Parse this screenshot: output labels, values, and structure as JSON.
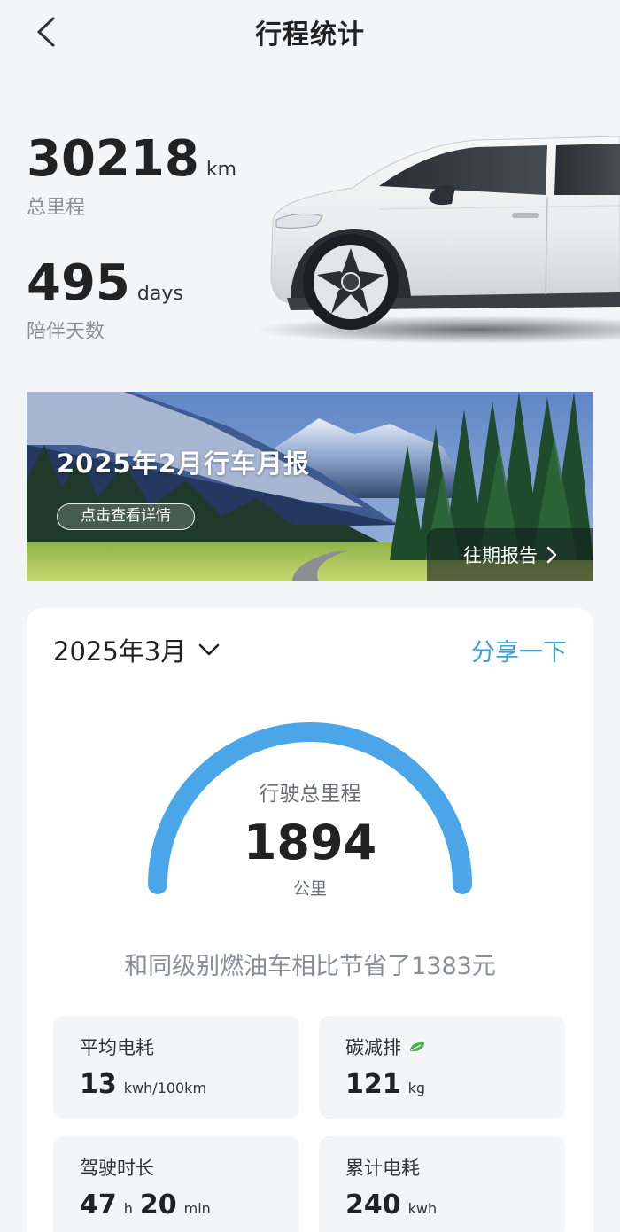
{
  "header": {
    "title": "行程统计"
  },
  "summary": {
    "total_mileage": {
      "value": "30218",
      "unit": "km",
      "label": "总里程"
    },
    "days": {
      "value": "495",
      "unit": "days",
      "label": "陪伴天数"
    }
  },
  "banner": {
    "title": "2025年2月行车月报",
    "detail_button": "点击查看详情",
    "history_button": "往期报告"
  },
  "card": {
    "month": "2025年3月",
    "share": "分享一下",
    "gauge": {
      "label": "行驶总里程",
      "value": "1894",
      "unit": "公里",
      "progress": 1.0
    },
    "saving_text": "和同级别燃油车相比节省了1383元",
    "tiles": [
      {
        "label": "平均电耗",
        "value": "13",
        "unit": "kwh/100km"
      },
      {
        "label": "碳减排",
        "value": "121",
        "unit": "kg"
      },
      {
        "label": "驾驶时长",
        "hours": "47",
        "hours_unit": "h",
        "minutes": "20",
        "minutes_unit": "min"
      },
      {
        "label": "累计电耗",
        "value": "240",
        "unit": "kwh"
      }
    ]
  },
  "colors": {
    "accent": "#3aa1dd",
    "gauge": "#4aa6e8",
    "leaf": "#4caf50"
  }
}
